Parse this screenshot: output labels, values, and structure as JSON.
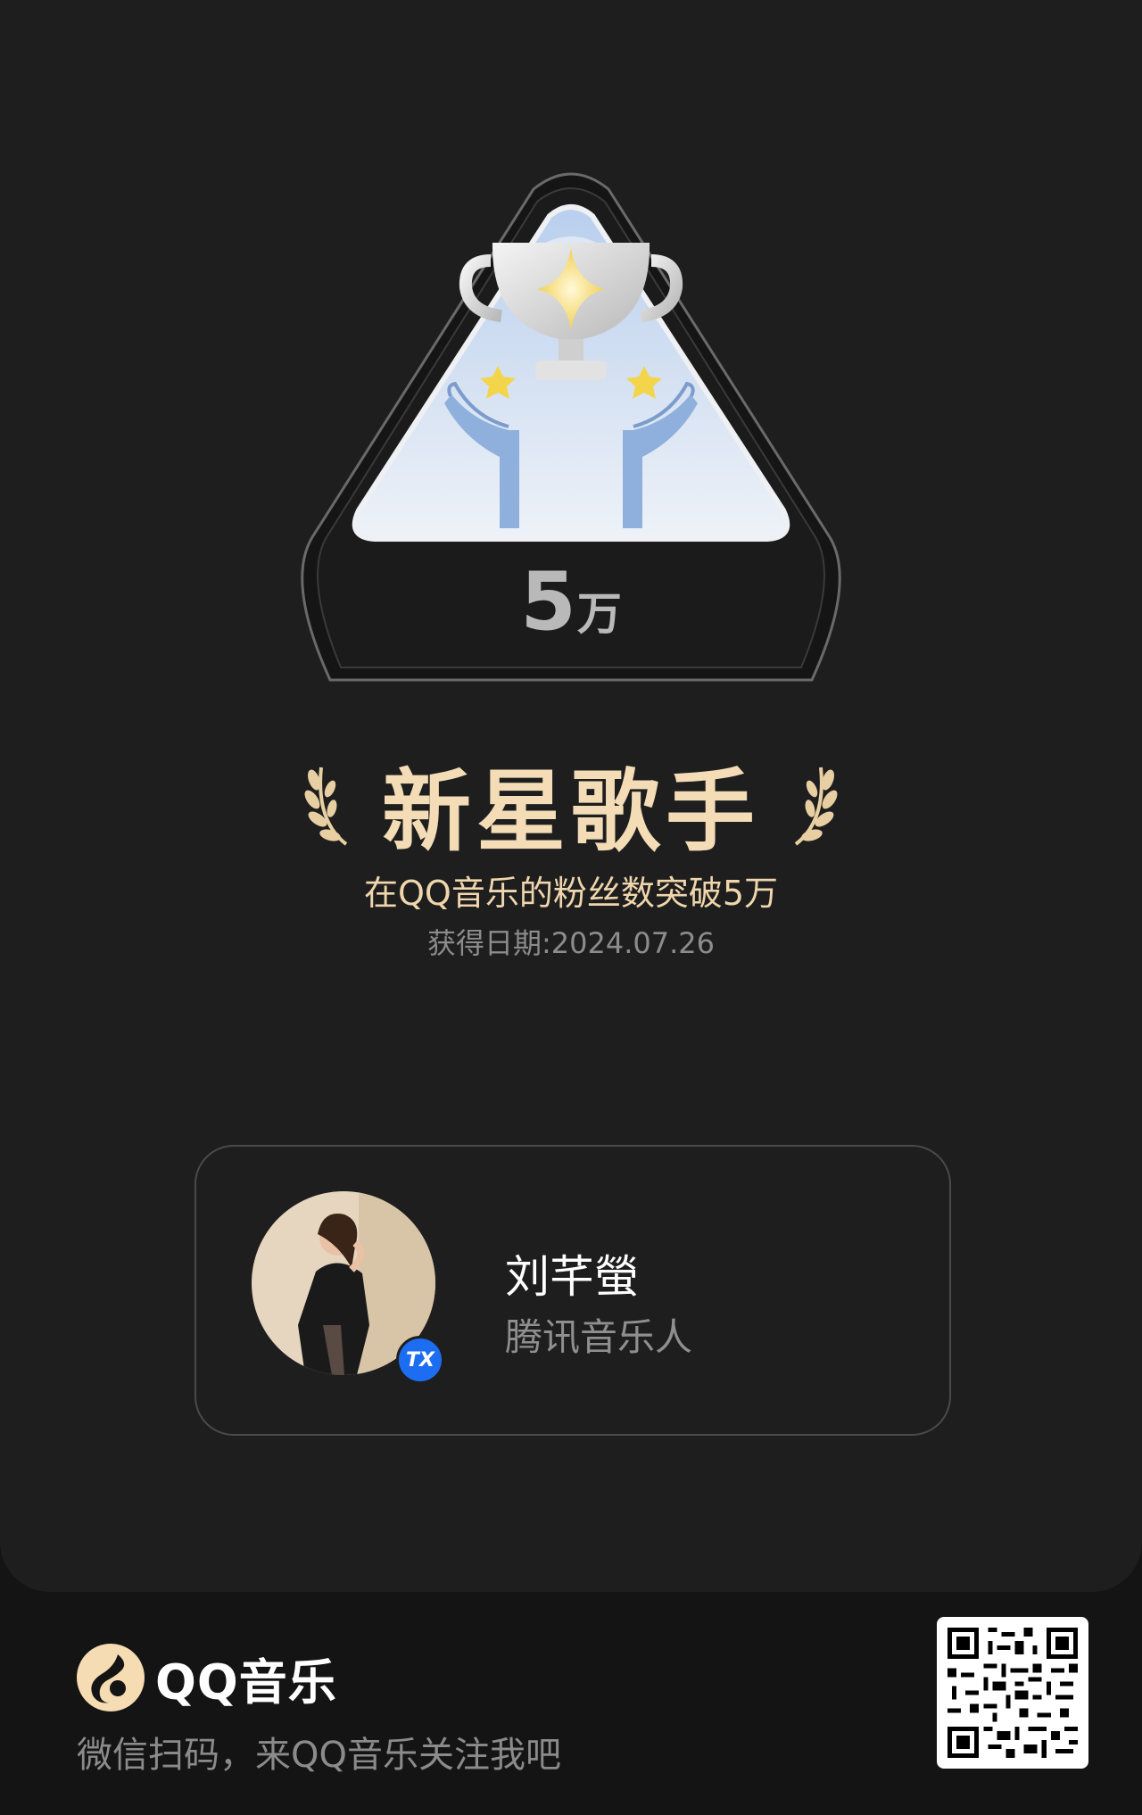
{
  "badge": {
    "count_number": "5",
    "count_unit": "万",
    "icon": "trophy-in-hands-icon"
  },
  "achievement": {
    "title": "新星歌手",
    "description": "在QQ音乐的粉丝数突破5万",
    "date_label": "获得日期:2024.07.26"
  },
  "profile": {
    "name": "刘芊螢",
    "role": "腾讯音乐人",
    "verified_badge": "TX"
  },
  "footer": {
    "brand": "QQ音乐",
    "cta": "微信扫码，来QQ音乐关注我吧"
  },
  "colors": {
    "background": "#1e1e1e",
    "title_gold": "#f3dcb6",
    "verified_blue": "#1d6df2"
  }
}
